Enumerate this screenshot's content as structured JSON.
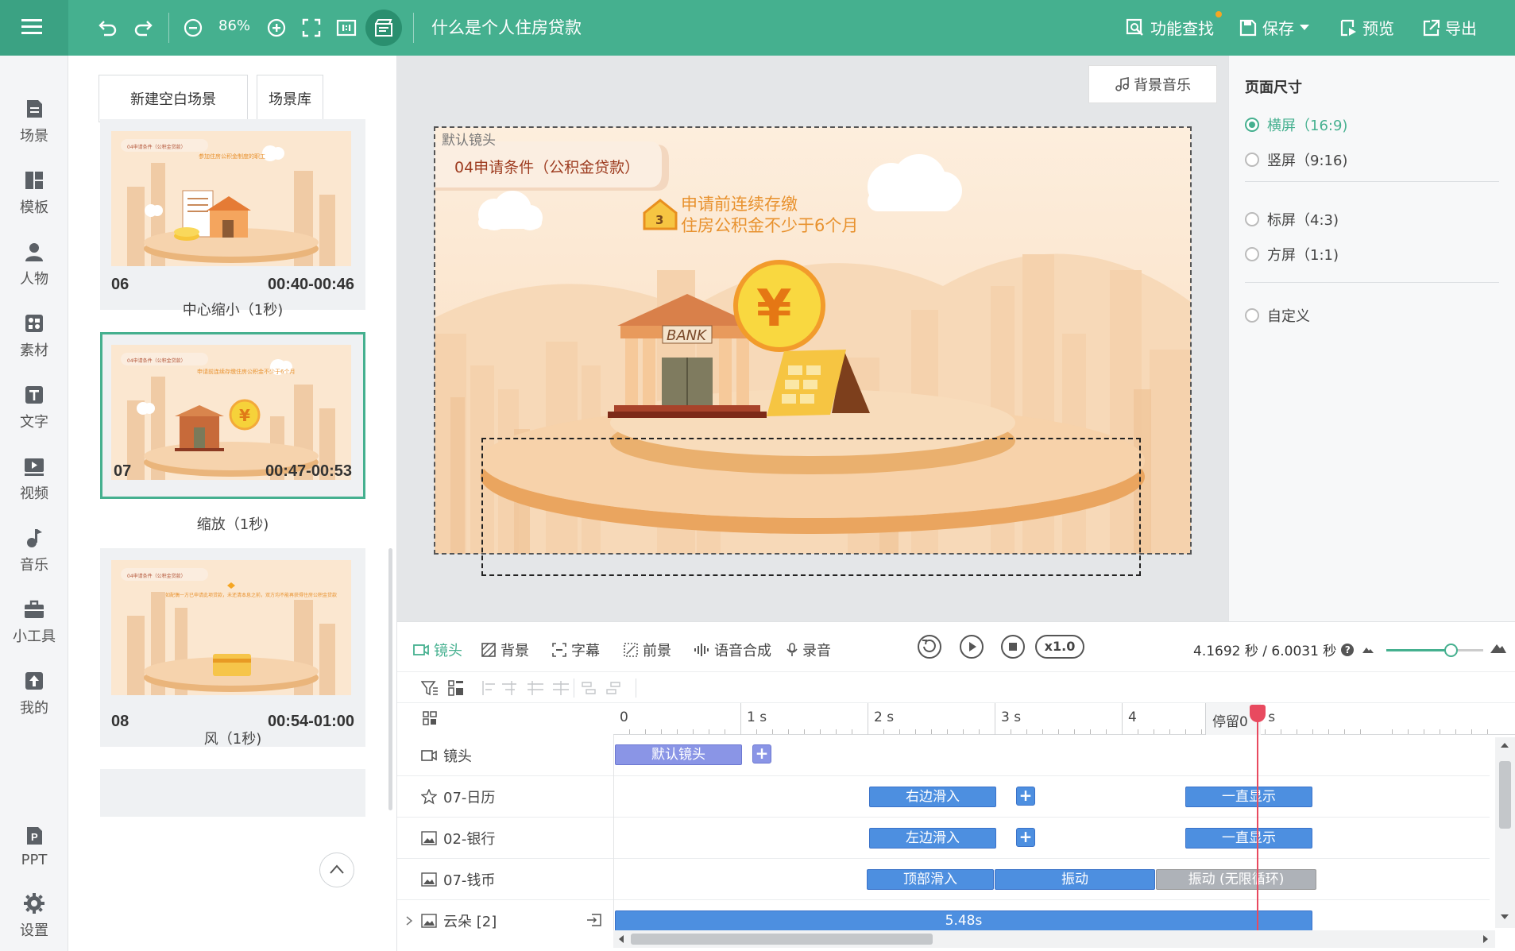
{
  "topbar": {
    "zoom": "86%",
    "doc_title": "什么是个人住房贷款",
    "actions": {
      "find": "功能查找",
      "save": "保存",
      "preview": "预览",
      "export": "导出"
    }
  },
  "leftnav": {
    "items": [
      {
        "label": "场景",
        "icon": "scene-icon"
      },
      {
        "label": "模板",
        "icon": "template-icon"
      },
      {
        "label": "人物",
        "icon": "person-icon"
      },
      {
        "label": "素材",
        "icon": "material-icon"
      },
      {
        "label": "文字",
        "icon": "text-icon"
      },
      {
        "label": "视频",
        "icon": "video-icon"
      },
      {
        "label": "音乐",
        "icon": "music-icon"
      },
      {
        "label": "小工具",
        "icon": "toolbox-icon"
      },
      {
        "label": "我的",
        "icon": "upload-icon"
      },
      {
        "label": "PPT",
        "icon": "ppt-icon"
      },
      {
        "label": "设置",
        "icon": "gear-icon"
      }
    ]
  },
  "scenes": {
    "new_blank": "新建空白场景",
    "library": "场景库",
    "cards": [
      {
        "num": "06",
        "time": "00:40-00:46",
        "transition": "中心缩小（1秒)",
        "title": "04申请条件（公积金贷款）",
        "caption": "参加住房公积金制度的职工"
      },
      {
        "num": "07",
        "time": "00:47-00:53",
        "transition": "缩放（1秒)",
        "title": "04申请条件（公积金贷款）",
        "caption": "申请前连续存缴住房公积金不少于6个月"
      },
      {
        "num": "08",
        "time": "00:54-01:00",
        "transition": "风（1秒)",
        "title": "04申请条件（公积金贷款）",
        "caption": "如配偶一方已申请此项贷款，未还清本息之前，双方均不能再获得住房公积金贷款"
      }
    ]
  },
  "canvas": {
    "bgm_button": "背景音乐",
    "camera_label": "默认镜头",
    "banner_title": "04申请条件（公积金贷款）",
    "badge_number": "3",
    "caption_line1": "申请前连续存缴",
    "caption_line2": "住房公积金不少于6个月",
    "bank_sign": "BANK",
    "coin_symbol": "¥"
  },
  "pagesize": {
    "title": "页面尺寸",
    "options": [
      {
        "label": "横屏（16:9)",
        "selected": true
      },
      {
        "label": "竖屏（9:16)",
        "selected": false
      },
      {
        "label": "标屏（4:3)",
        "selected": false
      },
      {
        "label": "方屏（1:1)",
        "selected": false
      },
      {
        "label": "自定义",
        "selected": false
      }
    ]
  },
  "timeline": {
    "tabs": [
      "镜头",
      "背景",
      "字幕",
      "前景",
      "语音合成",
      "录音"
    ],
    "speed": "x1.0",
    "current_time": "4.1692 秒 / 6.0031 秒",
    "help": "?",
    "ruler": [
      "0",
      "1 s",
      "2 s",
      "3 s",
      "4",
      "5 s"
    ],
    "hold": "停留0",
    "tracks": [
      {
        "name": "镜头",
        "icon": "camera-icon"
      },
      {
        "name": "07-日历",
        "icon": "effect-icon"
      },
      {
        "name": "02-银行",
        "icon": "image-icon"
      },
      {
        "name": "07-钱币",
        "icon": "image-icon"
      },
      {
        "name": "云朵 [2]",
        "icon": "group-icon"
      }
    ],
    "clips": {
      "camera_default": "默认镜头",
      "calendar_in": "右边滑入",
      "calendar_stay": "一直显示",
      "bank_in": "左边滑入",
      "bank_stay": "一直显示",
      "coin_in": "顶部滑入",
      "coin_shake": "振动",
      "coin_loop": "振动 (无限循环)",
      "cloud_duration": "5.48s"
    },
    "add": "+"
  },
  "colors": {
    "accent": "#45b08f",
    "clip_blue": "#4d8fe0",
    "camera_clip": "#8a95e6",
    "playhead": "#e84a5f"
  }
}
